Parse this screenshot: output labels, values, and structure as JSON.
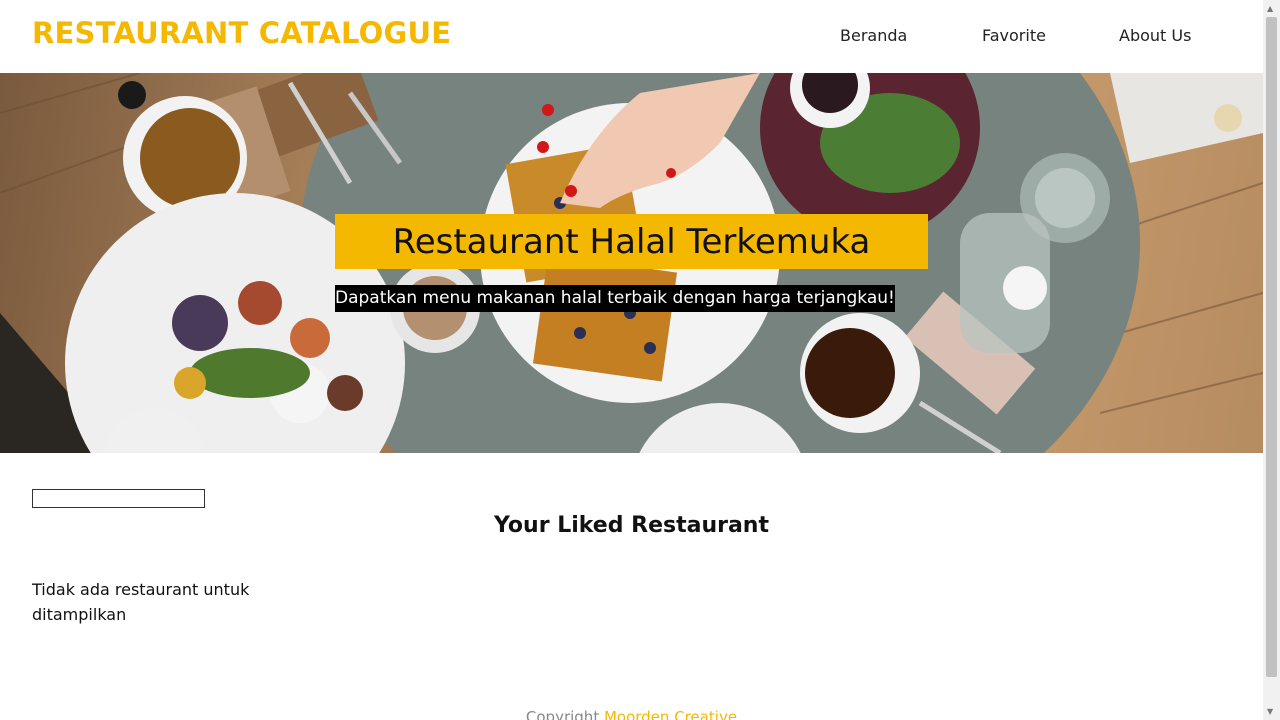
{
  "theme": {
    "accent": "#f5b800"
  },
  "header": {
    "brand": "RESTAURANT CATALOGUE",
    "nav": [
      {
        "label": "Beranda"
      },
      {
        "label": "Favorite"
      },
      {
        "label": "About Us"
      }
    ]
  },
  "hero": {
    "title": "Restaurant Halal Terkemuka",
    "subtitle": "Dapatkan menu makanan halal terbaik dengan harga terjangkau!"
  },
  "search": {
    "value": "",
    "placeholder": ""
  },
  "main": {
    "section_title": "Your Liked Restaurant",
    "empty_message": "Tidak ada restaurant untuk ditampilkan"
  },
  "footer": {
    "prefix": "Copyright ",
    "brand": "Moorden Creative"
  }
}
